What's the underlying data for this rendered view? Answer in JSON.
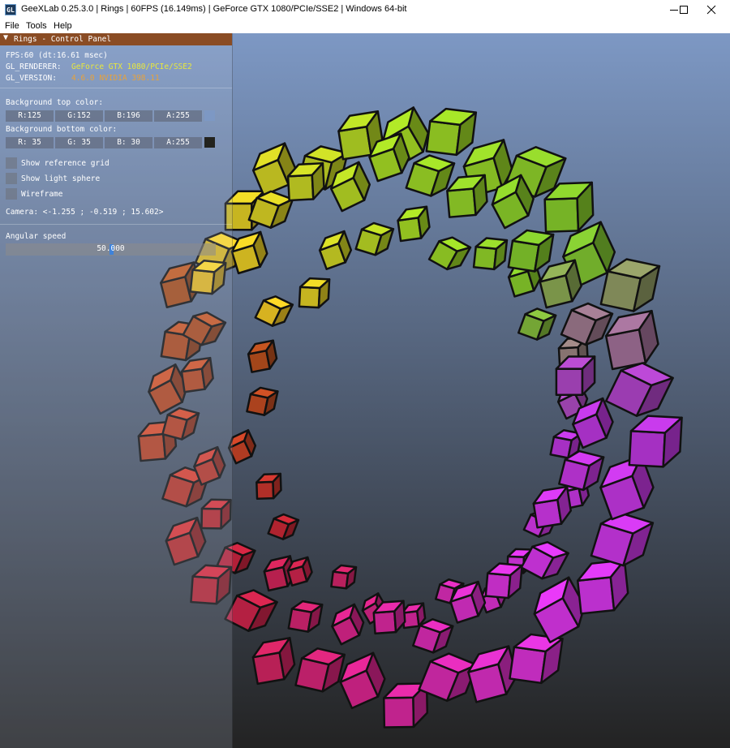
{
  "window": {
    "title": "GeeXLab 0.25.3.0 | Rings | 60FPS (16.149ms) | GeForce GTX 1080/PCIe/SSE2 | Windows 64-bit",
    "app_icon_text": "GL",
    "minimize_icon": "minimize-icon",
    "maximize_icon": "maximize-icon",
    "close_icon": "close-icon"
  },
  "menu": {
    "items": [
      "File",
      "Tools",
      "Help"
    ]
  },
  "panel": {
    "title": "Rings - Control Panel",
    "collapse_icon": "▼",
    "fps": "FPS:60 (dt:16.61 msec)",
    "renderer_label": "GL_RENDERER:",
    "renderer_value": "GeForce GTX 1080/PCIe/SSE2",
    "version_label": "GL_VERSION:",
    "version_value": "4.6.0 NVIDIA 398.11",
    "bg_top_label": "Background top color:",
    "bg_top": {
      "r": "R:125",
      "g": "G:152",
      "b": "B:196",
      "a": "A:255",
      "swatch": "#7d98c4"
    },
    "bg_bottom_label": "Background bottom color:",
    "bg_bottom": {
      "r": "R: 35",
      "g": "G: 35",
      "b": "B: 30",
      "a": "A:255",
      "swatch": "#23231e"
    },
    "options": [
      "Show reference grid",
      "Show light sphere",
      "Wireframe"
    ],
    "camera": "Camera: <-1.255 ; -0.519 ; 15.602>",
    "angular_speed_label": "Angular speed",
    "angular_speed_value": "50.000",
    "angular_speed_fraction": 0.5
  },
  "colors": {
    "panel_header": "#8a4c24",
    "renderer_text": "#e8e83c",
    "version_text": "#e8a23a",
    "slider_grab": "#3f82d9"
  }
}
